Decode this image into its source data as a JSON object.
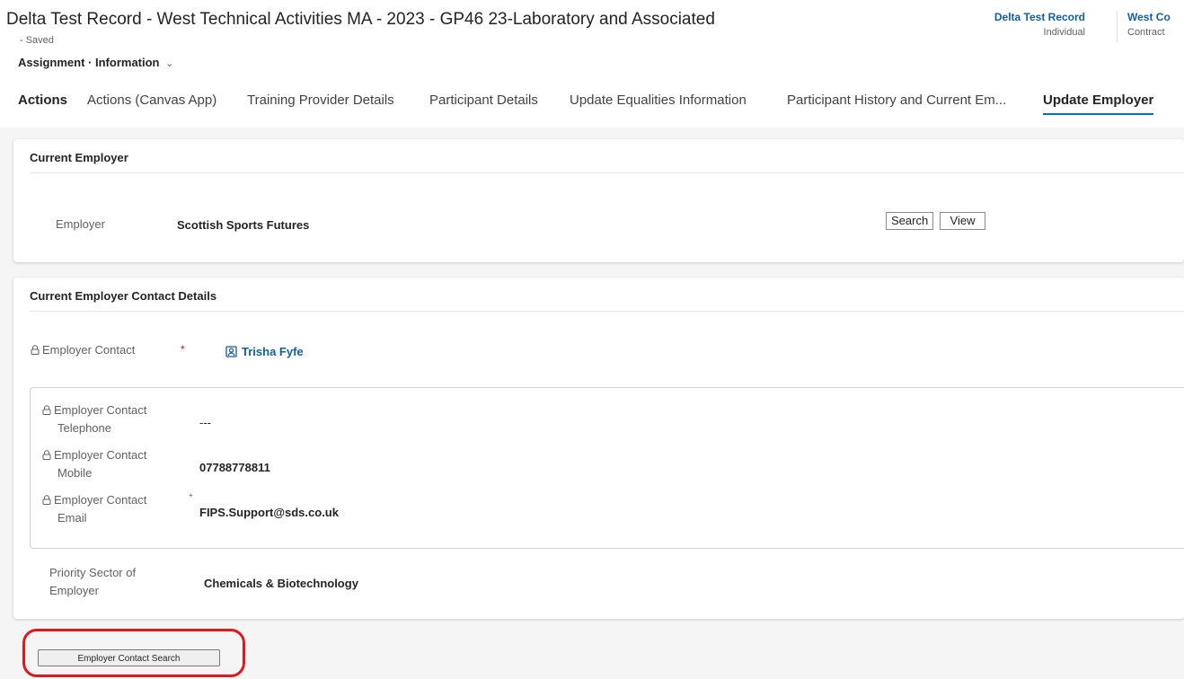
{
  "header": {
    "title": "Delta Test Record  - West Technical Activities MA - 2023 - GP46 23-Laboratory and Associated",
    "saved": "- Saved",
    "form_selector": {
      "entity": "Assignment",
      "separator": "·",
      "form": "Information"
    },
    "related": [
      {
        "value": "Delta Test Record",
        "label": "Individual"
      },
      {
        "value": "West Co",
        "label": "Contract"
      }
    ]
  },
  "tabs": [
    {
      "label": "Actions",
      "active": false
    },
    {
      "label": "Actions (Canvas App)",
      "active": false
    },
    {
      "label": "Training Provider Details",
      "active": false
    },
    {
      "label": "Participant Details",
      "active": false
    },
    {
      "label": "Update Equalities Information",
      "active": false
    },
    {
      "label": "Participant History and Current Em...",
      "active": false
    },
    {
      "label": "Update Employer",
      "active": true
    }
  ],
  "current_employer": {
    "section_title": "Current Employer",
    "employer_label": "Employer",
    "employer_value": "Scottish Sports Futures",
    "search_button": "Search",
    "view_button": "View"
  },
  "contact_details": {
    "section_title": "Current Employer Contact Details",
    "employer_contact_label": "Employer Contact",
    "employer_contact_required": "*",
    "employer_contact_value": "Trisha Fyfe",
    "telephone_label_1": "Employer Contact",
    "telephone_label_2": "Telephone",
    "telephone_value": "---",
    "mobile_label_1": "Employer Contact",
    "mobile_label_2": "Mobile",
    "mobile_value": "07788778811",
    "email_label_1": "Employer Contact",
    "email_label_2": "Email",
    "email_recommended": "+",
    "email_value": "FIPS.Support@sds.co.uk",
    "priority_label_1": "Priority Sector of",
    "priority_label_2": "Employer",
    "priority_value": "Chemicals & Biotechnology"
  },
  "actions": {
    "employer_contact_search": "Employer Contact Search"
  },
  "colors": {
    "accent": "#0f6cbd",
    "link": "#115ea3",
    "required": "#c50f1f",
    "highlight": "#e0191e"
  },
  "icons": {
    "lock": "lock-icon",
    "contact": "contact-card-icon",
    "chevron": "chevron-down-icon"
  }
}
